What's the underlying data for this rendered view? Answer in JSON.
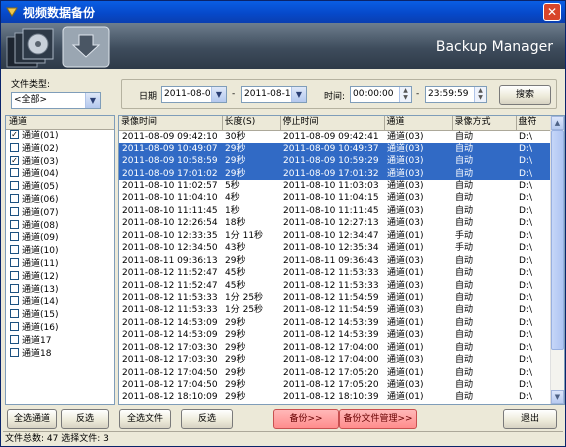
{
  "window": {
    "title": "视频数据备份",
    "close_glyph": "✕"
  },
  "banner": {
    "title": "Backup Manager"
  },
  "filter": {
    "file_type_label": "文件类型:",
    "file_type_value": "<全部>",
    "date_label": "日期",
    "date_from": "2011-08-09",
    "date_to": "2011-08-17",
    "dash1": "-",
    "time_label": "时间:",
    "time_from": "00:00:00",
    "dash2": "-",
    "time_to": "23:59:59",
    "search_button": "搜索"
  },
  "channels": {
    "header": "通道",
    "items": [
      {
        "label": "通道(01)",
        "checked": true
      },
      {
        "label": "通道(02)",
        "checked": false
      },
      {
        "label": "通道(03)",
        "checked": true
      },
      {
        "label": "通道(04)",
        "checked": false
      },
      {
        "label": "通道(05)",
        "checked": false
      },
      {
        "label": "通道(06)",
        "checked": false
      },
      {
        "label": "通道(07)",
        "checked": false
      },
      {
        "label": "通道(08)",
        "checked": false
      },
      {
        "label": "通道(09)",
        "checked": false
      },
      {
        "label": "通道(10)",
        "checked": false
      },
      {
        "label": "通道(11)",
        "checked": false
      },
      {
        "label": "通道(12)",
        "checked": false
      },
      {
        "label": "通道(13)",
        "checked": false
      },
      {
        "label": "通道(14)",
        "checked": false
      },
      {
        "label": "通道(15)",
        "checked": false
      },
      {
        "label": "通道(16)",
        "checked": false
      },
      {
        "label": "通道17",
        "checked": false
      },
      {
        "label": "通道18",
        "checked": false
      }
    ],
    "check_glyph": "✓"
  },
  "records": {
    "columns": [
      "录像时间",
      "长度(S)",
      "停止时间",
      "通道",
      "录像方式",
      "盘符"
    ],
    "rows": [
      [
        "2011-08-09 09:42:10",
        "30秒",
        "2011-08-09 09:42:41",
        "通道(03)",
        "自动",
        "D:\\",
        false
      ],
      [
        "2011-08-09 10:49:07",
        "29秒",
        "2011-08-09 10:49:37",
        "通道(03)",
        "自动",
        "D:\\",
        true
      ],
      [
        "2011-08-09 10:58:59",
        "29秒",
        "2011-08-09 10:59:29",
        "通道(03)",
        "自动",
        "D:\\",
        true
      ],
      [
        "2011-08-09 17:01:02",
        "29秒",
        "2011-08-09 17:01:32",
        "通道(03)",
        "自动",
        "D:\\",
        true
      ],
      [
        "2011-08-10 11:02:57",
        "5秒",
        "2011-08-10 11:03:03",
        "通道(03)",
        "自动",
        "D:\\",
        false
      ],
      [
        "2011-08-10 11:04:10",
        "4秒",
        "2011-08-10 11:04:15",
        "通道(03)",
        "自动",
        "D:\\",
        false
      ],
      [
        "2011-08-10 11:11:45",
        "1秒",
        "2011-08-10 11:11:45",
        "通道(03)",
        "自动",
        "D:\\",
        false
      ],
      [
        "2011-08-10 12:26:54",
        "18秒",
        "2011-08-10 12:27:13",
        "通道(03)",
        "自动",
        "D:\\",
        false
      ],
      [
        "2011-08-10 12:33:35",
        "1分 11秒",
        "2011-08-10 12:34:47",
        "通道(01)",
        "手动",
        "D:\\",
        false
      ],
      [
        "2011-08-10 12:34:50",
        "43秒",
        "2011-08-10 12:35:34",
        "通道(01)",
        "手动",
        "D:\\",
        false
      ],
      [
        "2011-08-11 09:36:13",
        "29秒",
        "2011-08-11 09:36:43",
        "通道(03)",
        "自动",
        "D:\\",
        false
      ],
      [
        "2011-08-12 11:52:47",
        "45秒",
        "2011-08-12 11:53:33",
        "通道(01)",
        "自动",
        "D:\\",
        false
      ],
      [
        "2011-08-12 11:52:47",
        "45秒",
        "2011-08-12 11:53:33",
        "通道(03)",
        "自动",
        "D:\\",
        false
      ],
      [
        "2011-08-12 11:53:33",
        "1分 25秒",
        "2011-08-12 11:54:59",
        "通道(01)",
        "自动",
        "D:\\",
        false
      ],
      [
        "2011-08-12 11:53:33",
        "1分 25秒",
        "2011-08-12 11:54:59",
        "通道(03)",
        "自动",
        "D:\\",
        false
      ],
      [
        "2011-08-12 14:53:09",
        "29秒",
        "2011-08-12 14:53:39",
        "通道(01)",
        "自动",
        "D:\\",
        false
      ],
      [
        "2011-08-12 14:53:09",
        "29秒",
        "2011-08-12 14:53:39",
        "通道(03)",
        "自动",
        "D:\\",
        false
      ],
      [
        "2011-08-12 17:03:30",
        "29秒",
        "2011-08-12 17:04:00",
        "通道(01)",
        "自动",
        "D:\\",
        false
      ],
      [
        "2011-08-12 17:03:30",
        "29秒",
        "2011-08-12 17:04:00",
        "通道(03)",
        "自动",
        "D:\\",
        false
      ],
      [
        "2011-08-12 17:04:50",
        "29秒",
        "2011-08-12 17:05:20",
        "通道(01)",
        "自动",
        "D:\\",
        false
      ],
      [
        "2011-08-12 17:04:50",
        "29秒",
        "2011-08-12 17:05:20",
        "通道(03)",
        "自动",
        "D:\\",
        false
      ],
      [
        "2011-08-12 18:10:09",
        "29秒",
        "2011-08-12 18:10:39",
        "通道(01)",
        "自动",
        "D:\\",
        false
      ],
      [
        "2011-08-12 18:10:09",
        "29秒",
        "2011-08-12 18:10:39",
        "通道(03)",
        "自动",
        "D:\\",
        false
      ]
    ]
  },
  "buttons": {
    "select_all_channels": "全选通道",
    "invert_channels": "反选",
    "select_all_files": "全选文件",
    "invert_files": "反选",
    "backup": "备份>>",
    "backup_manage": "备份文件管理>>",
    "exit": "退出"
  },
  "status": {
    "text": "文件总数: 47  选择文件: 3"
  },
  "colors": {
    "selection": "#316ac5",
    "title_bar": "#0648c8",
    "backup_button": "#ff8c8c"
  },
  "icons": {
    "app": "app-icon",
    "close": "close-icon",
    "scroll_up": "scroll-up-icon",
    "scroll_down": "scroll-down-icon"
  }
}
